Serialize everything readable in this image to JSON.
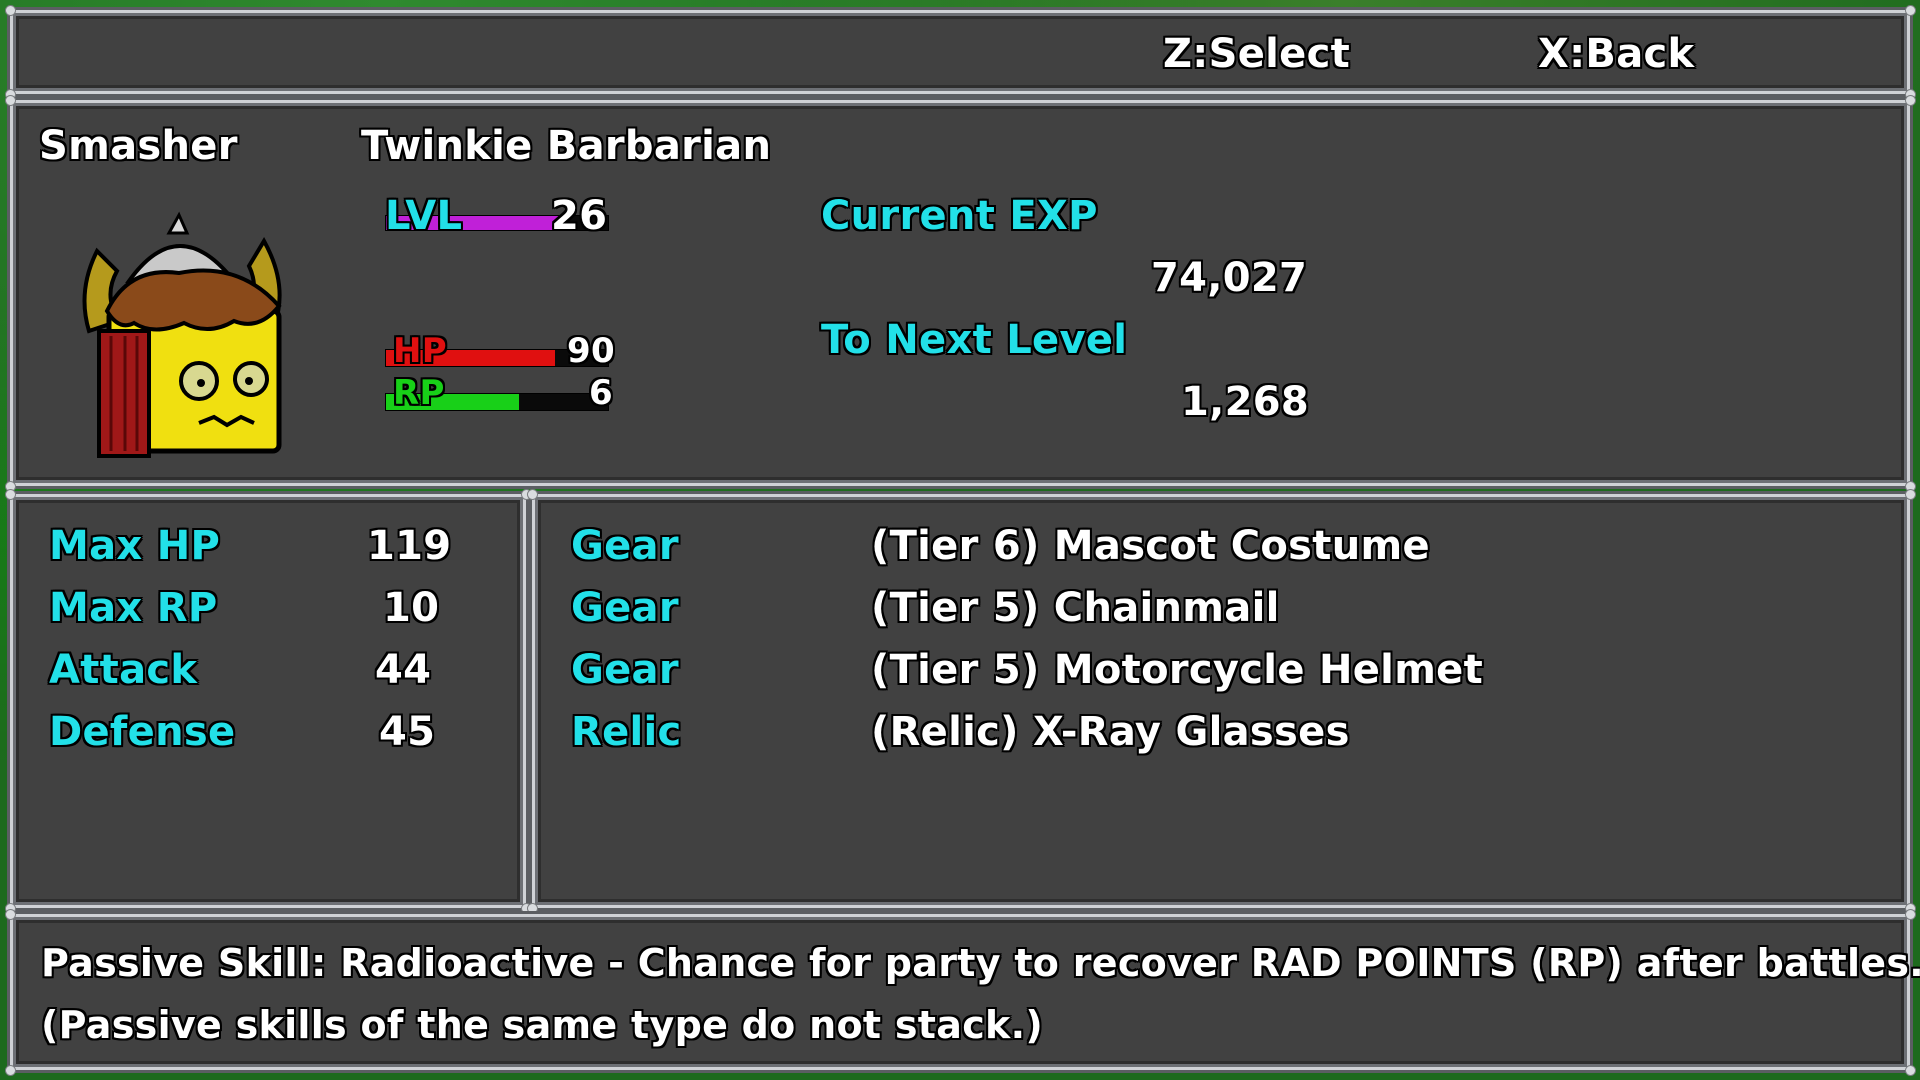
{
  "header": {
    "select_label": "Z:Select",
    "back_label": "X:Back"
  },
  "character": {
    "name": "Smasher",
    "class": "Twinkie Barbarian",
    "level_label": "LVL",
    "level": "26",
    "level_progress": 0.82,
    "hp_label": "HP",
    "hp": "90",
    "hp_fraction": 0.76,
    "rp_label": "RP",
    "rp": "6",
    "rp_fraction": 0.6,
    "current_exp_label": "Current EXP",
    "current_exp": "74,027",
    "to_next_label": "To Next Level",
    "to_next": "1,268"
  },
  "stats": [
    {
      "label": "Max HP",
      "value": "119"
    },
    {
      "label": "Max RP",
      "value": "10"
    },
    {
      "label": "Attack",
      "value": "44"
    },
    {
      "label": "Defense",
      "value": "45"
    }
  ],
  "equipment": [
    {
      "slot": "Gear",
      "item": "(Tier 6) Mascot Costume"
    },
    {
      "slot": "Gear",
      "item": "(Tier 5) Chainmail"
    },
    {
      "slot": "Gear",
      "item": "(Tier 5) Motorcycle Helmet"
    },
    {
      "slot": "Relic",
      "item": "(Relic) X-Ray Glasses"
    }
  ],
  "skill": {
    "line1": "Passive Skill: Radioactive - Chance for party to recover RAD POINTS (RP) after battles.",
    "line2": "(Passive skills of the same type do not stack.)"
  },
  "colors": {
    "level_bar": "#c020d8",
    "hp_bar": "#e01010",
    "rp_bar": "#18d018",
    "label_cyan": "#22e0e8"
  },
  "icons": {
    "portrait": "twinkie-barbarian-portrait"
  }
}
